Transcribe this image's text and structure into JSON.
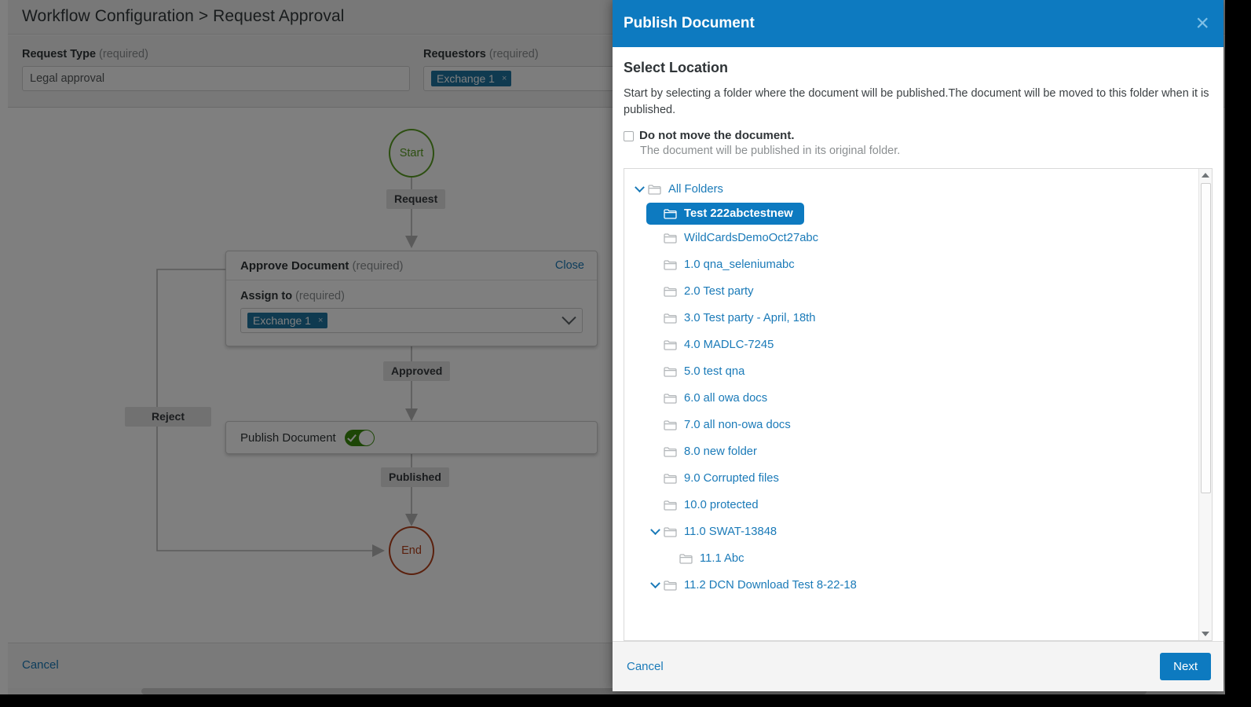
{
  "background": {
    "title": "Workflow Configuration > Request Approval",
    "request_type": {
      "label": "Request Type",
      "required_suffix": "(required)",
      "value": "Legal approval"
    },
    "requestors": {
      "label": "Requestors",
      "required_suffix": "(required)",
      "token": "Exchange 1",
      "token_remove": "×"
    },
    "cancel_label": "Cancel"
  },
  "workflow": {
    "start_node": "Start",
    "end_node": "End",
    "edge_request": "Request",
    "edge_approved": "Approved",
    "edge_published": "Published",
    "edge_reject": "Reject",
    "approve_card": {
      "title": "Approve Document",
      "required_suffix": "(required)",
      "close_label": "Close",
      "assign_label": "Assign to",
      "assign_required_suffix": "(required)",
      "assign_token": "Exchange 1",
      "assign_token_remove": "×"
    },
    "publish_card": {
      "title": "Publish Document",
      "toggle_state": "on"
    },
    "colors": {
      "start": "#5a9e23",
      "end": "#b5401b",
      "toggle_on": "#3b8c0c",
      "link": "#1a7ab8"
    }
  },
  "dialog": {
    "title": "Publish Document",
    "close_icon": "×",
    "section_heading": "Select Location",
    "description": "Start by selecting a folder where the document will be published.The document will be moved to this folder when it is published.",
    "checkbox": {
      "label": "Do not move the document.",
      "sublabel": "The document will be published in its original folder.",
      "checked": false
    },
    "footer": {
      "cancel_label": "Cancel",
      "next_label": "Next"
    },
    "accent_color": "#0d7ac0",
    "tree": [
      {
        "label": "All Folders",
        "depth": 0,
        "expanded": true,
        "selected": false
      },
      {
        "label": "Test 222abctestnew",
        "depth": 1,
        "expanded": null,
        "selected": true
      },
      {
        "label": "WildCardsDemoOct27abc",
        "depth": 1,
        "expanded": null,
        "selected": false
      },
      {
        "label": "1.0 qna_seleniumabc",
        "depth": 1,
        "expanded": null,
        "selected": false
      },
      {
        "label": "2.0 Test party",
        "depth": 1,
        "expanded": null,
        "selected": false
      },
      {
        "label": "3.0 Test party - April, 18th",
        "depth": 1,
        "expanded": null,
        "selected": false
      },
      {
        "label": "4.0 MADLC-7245",
        "depth": 1,
        "expanded": null,
        "selected": false
      },
      {
        "label": "5.0 test qna",
        "depth": 1,
        "expanded": null,
        "selected": false
      },
      {
        "label": "6.0 all owa docs",
        "depth": 1,
        "expanded": null,
        "selected": false
      },
      {
        "label": "7.0 all non-owa docs",
        "depth": 1,
        "expanded": null,
        "selected": false
      },
      {
        "label": "8.0 new folder",
        "depth": 1,
        "expanded": null,
        "selected": false
      },
      {
        "label": "9.0 Corrupted files",
        "depth": 1,
        "expanded": null,
        "selected": false
      },
      {
        "label": "10.0 protected",
        "depth": 1,
        "expanded": null,
        "selected": false
      },
      {
        "label": "11.0 SWAT-13848",
        "depth": 1,
        "expanded": true,
        "selected": false
      },
      {
        "label": "11.1 Abc",
        "depth": 2,
        "expanded": null,
        "selected": false
      },
      {
        "label": "11.2 DCN Download Test 8-22-18",
        "depth": 1,
        "expanded": true,
        "selected": false
      }
    ]
  }
}
